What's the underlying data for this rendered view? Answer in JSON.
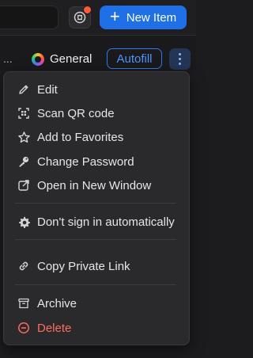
{
  "toolbar": {
    "new_item_label": "New Item",
    "plus_glyph": "+"
  },
  "item_bar": {
    "ellipsis": "...",
    "vault_name": "General",
    "autofill_label": "Autofill"
  },
  "menu": {
    "items": [
      {
        "label": "Edit",
        "icon": "pencil-icon"
      },
      {
        "label": "Scan QR code",
        "icon": "qr-scan-icon"
      },
      {
        "label": "Add to Favorites",
        "icon": "star-icon"
      },
      {
        "label": "Change Password",
        "icon": "key-icon"
      },
      {
        "label": "Open in New Window",
        "icon": "external-window-icon"
      },
      {
        "label": "Don't sign in automatically",
        "icon": "gear-icon"
      },
      {
        "label": "Copy Private Link",
        "icon": "link-icon"
      },
      {
        "label": "Archive",
        "icon": "archive-icon"
      },
      {
        "label": "Delete",
        "icon": "delete-icon"
      }
    ]
  },
  "colors": {
    "accent": "#1f6fe6",
    "danger": "#ff6b5e",
    "notification_dot": "#ff5a3c"
  }
}
